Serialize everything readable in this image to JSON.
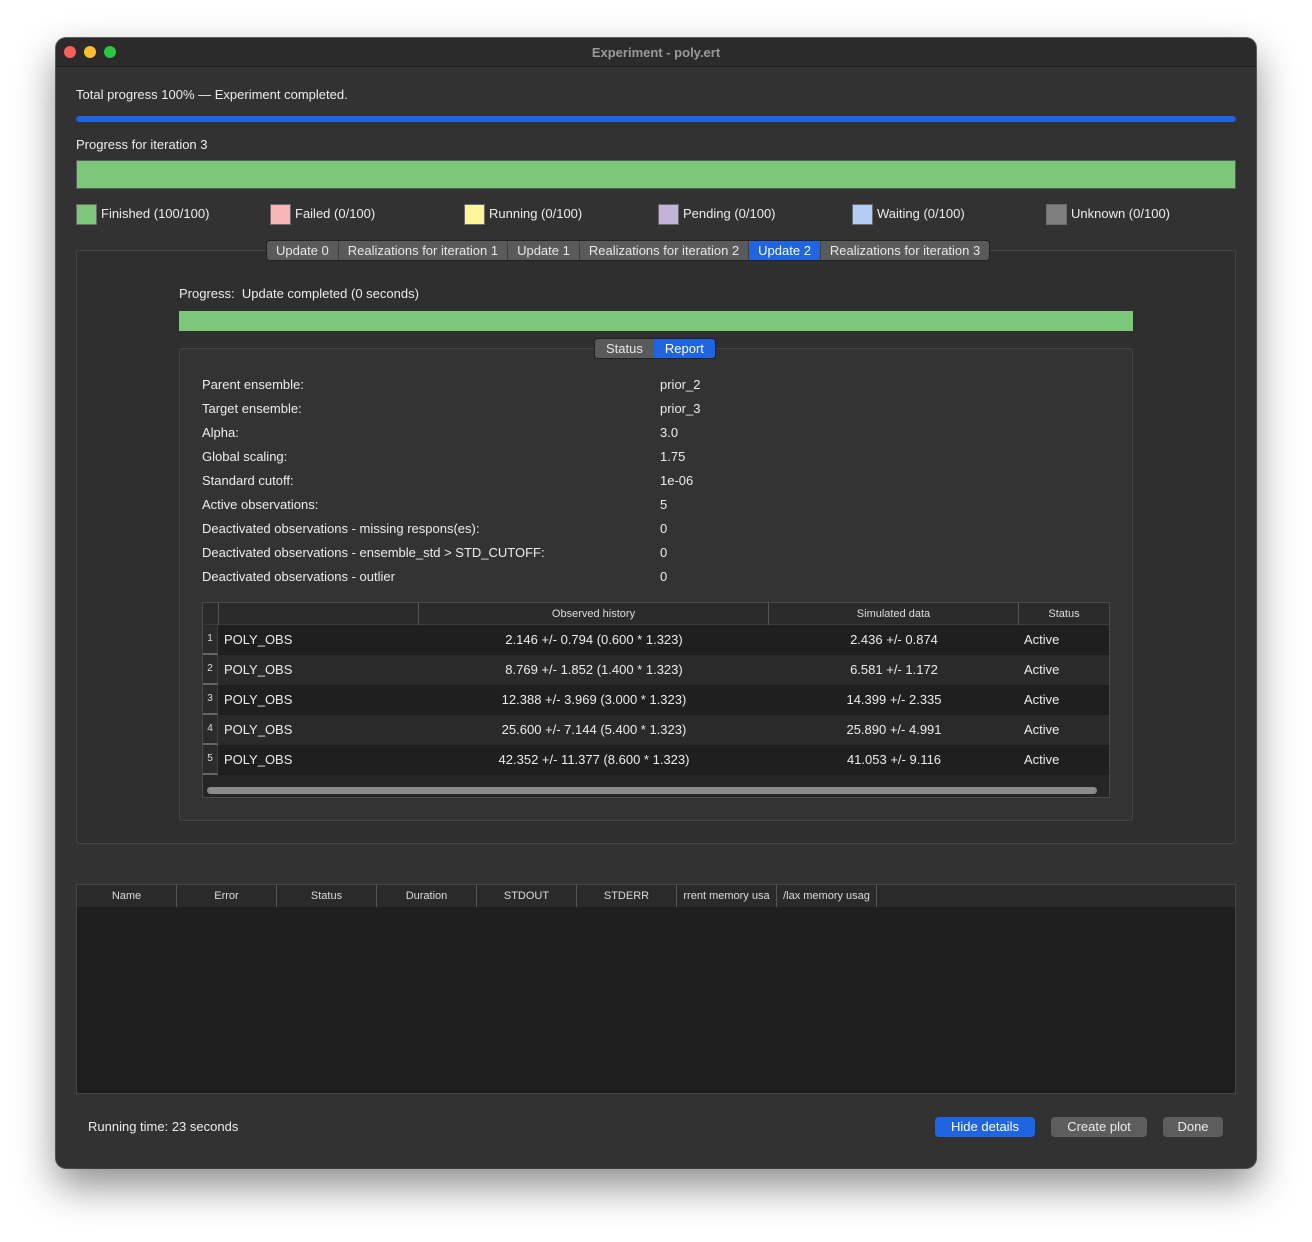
{
  "window": {
    "title": "Experiment - poly.ert"
  },
  "total_progress": {
    "label": "Total progress 100% — Experiment completed.",
    "value_percent": 100,
    "color": "#1f64e0"
  },
  "iteration_progress": {
    "label": "Progress for iteration 3",
    "value_percent": 100,
    "color": "#7cc87a"
  },
  "legend": [
    {
      "label": "Finished (100/100)",
      "color": "#7cc87a"
    },
    {
      "label": "Failed (0/100)",
      "color": "#f8b6b6"
    },
    {
      "label": "Running (0/100)",
      "color": "#fbf79a"
    },
    {
      "label": "Pending (0/100)",
      "color": "#c3b3d8"
    },
    {
      "label": "Waiting (0/100)",
      "color": "#b3cdf6"
    },
    {
      "label": "Unknown (0/100)",
      "color": "#7f7f7f"
    }
  ],
  "tabs": [
    {
      "label": "Update 0",
      "active": false
    },
    {
      "label": "Realizations for iteration 1",
      "active": false
    },
    {
      "label": "Update 1",
      "active": false
    },
    {
      "label": "Realizations for iteration 2",
      "active": false
    },
    {
      "label": "Update 2",
      "active": true
    },
    {
      "label": "Realizations for iteration 3",
      "active": false
    }
  ],
  "update": {
    "progress_label": "Progress:",
    "progress_status": "Update completed (0 seconds)",
    "progress_percent": 100,
    "subtabs": [
      {
        "label": "Status",
        "active": false
      },
      {
        "label": "Report",
        "active": true
      }
    ],
    "report": [
      {
        "key": "Parent ensemble:",
        "value": "prior_2"
      },
      {
        "key": "Target ensemble:",
        "value": "prior_3"
      },
      {
        "key": "Alpha:",
        "value": "3.0"
      },
      {
        "key": "Global scaling:",
        "value": "1.75"
      },
      {
        "key": "Standard cutoff:",
        "value": "1e-06"
      },
      {
        "key": "Active observations:",
        "value": "5"
      },
      {
        "key": "Deactivated observations - missing respons(es):",
        "value": "0"
      },
      {
        "key": "Deactivated observations - ensemble_std > STD_CUTOFF:",
        "value": "0"
      },
      {
        "key": "Deactivated observations - outlier",
        "value": "0"
      }
    ],
    "table": {
      "headers": [
        "",
        "Observed history",
        "Simulated data",
        "Status"
      ],
      "rows": [
        {
          "num": "1",
          "name": "POLY_OBS",
          "observed": "2.146 +/- 0.794 (0.600 * 1.323)",
          "simulated": "2.436 +/- 0.874",
          "status": "Active"
        },
        {
          "num": "2",
          "name": "POLY_OBS",
          "observed": "8.769 +/- 1.852 (1.400 * 1.323)",
          "simulated": "6.581 +/- 1.172",
          "status": "Active"
        },
        {
          "num": "3",
          "name": "POLY_OBS",
          "observed": "12.388 +/- 3.969 (3.000 * 1.323)",
          "simulated": "14.399 +/- 2.335",
          "status": "Active"
        },
        {
          "num": "4",
          "name": "POLY_OBS",
          "observed": "25.600 +/- 7.144 (5.400 * 1.323)",
          "simulated": "25.890 +/- 4.991",
          "status": "Active"
        },
        {
          "num": "5",
          "name": "POLY_OBS",
          "observed": "42.352 +/- 11.377 (8.600 * 1.323)",
          "simulated": "41.053 +/- 9.116",
          "status": "Active"
        }
      ]
    }
  },
  "jobs": {
    "headers": [
      "Name",
      "Error",
      "Status",
      "Duration",
      "STDOUT",
      "STDERR",
      "rrent memory usa",
      "/lax memory usag"
    ]
  },
  "footer": {
    "running_time": "Running time: 23 seconds",
    "hide_details": "Hide details",
    "create_plot": "Create plot",
    "done": "Done"
  }
}
